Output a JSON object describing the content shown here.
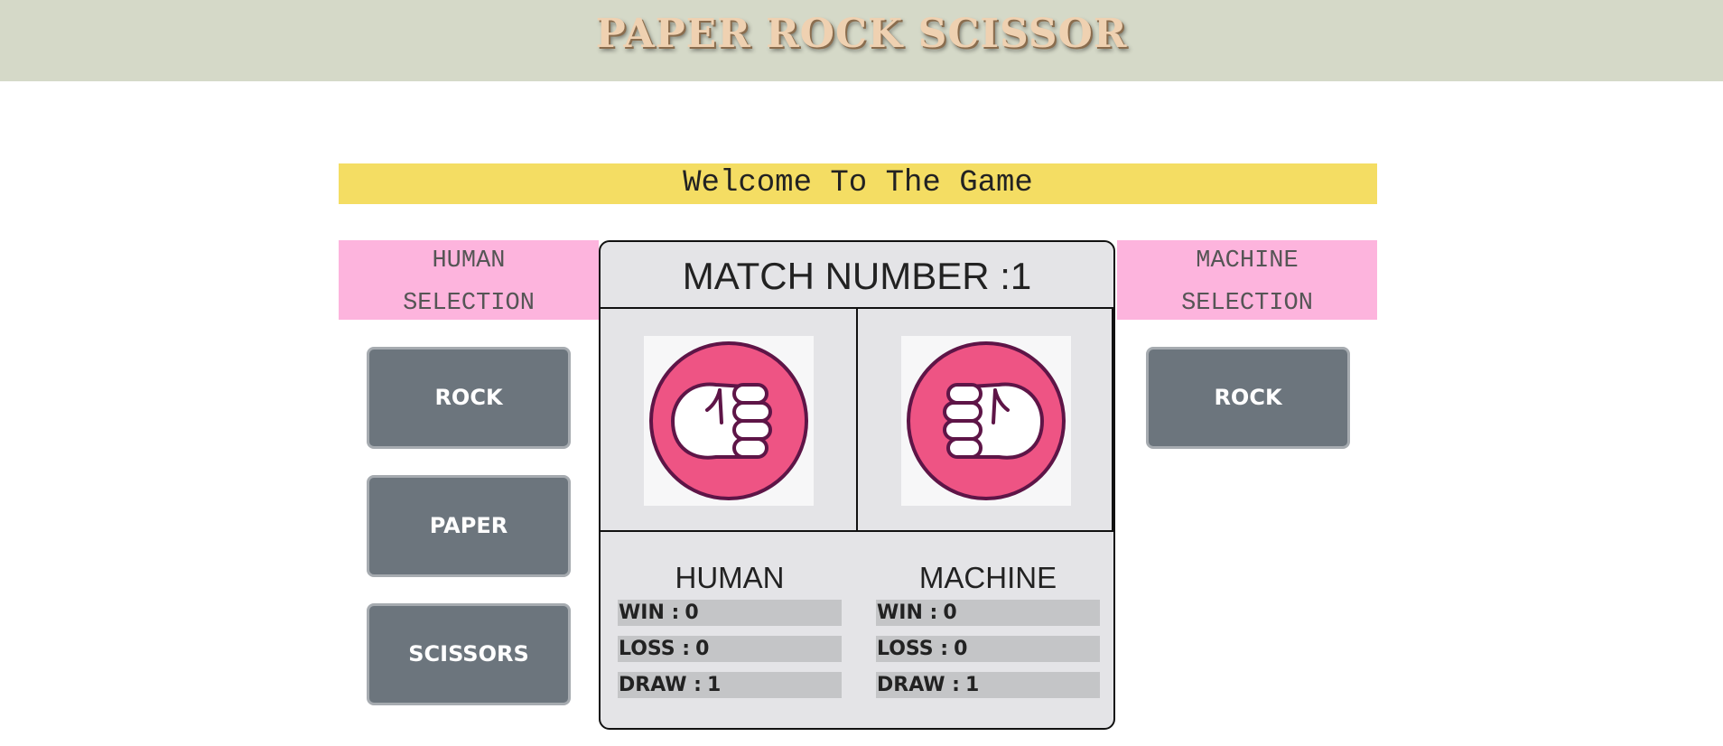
{
  "header": {
    "title": "PAPER ROCK SCISSOR"
  },
  "welcome": "Welcome To The Game",
  "human_panel": {
    "title_line1": "HUMAN",
    "title_line2": "SELECTION",
    "buttons": [
      "ROCK",
      "PAPER",
      "SCISSORS"
    ]
  },
  "machine_panel": {
    "title_line1": "MACHINE",
    "title_line2": "SELECTION",
    "selection": "ROCK"
  },
  "board": {
    "match_label": "MATCH NUMBER :",
    "match_number": "1",
    "human_pick_icon": "fist-right-icon",
    "machine_pick_icon": "fist-left-icon",
    "human": {
      "name": "HUMAN",
      "win_label": "WIN :",
      "win": "0",
      "loss_label": "LOSS :",
      "loss": "0",
      "draw_label": "DRAW :",
      "draw": "1"
    },
    "machine": {
      "name": "MACHINE",
      "win_label": "WIN :",
      "win": "0",
      "loss_label": "LOSS :",
      "loss": "0",
      "draw_label": "DRAW :",
      "draw": "1"
    }
  },
  "colors": {
    "header_bg": "#d5d9c8",
    "welcome_bg": "#f4dd63",
    "selection_header_bg": "#fdb4dd",
    "button_bg": "#6c757d",
    "board_bg": "#e4e4e7",
    "stat_bg": "#c4c5c7",
    "icon_fill": "#ee5484",
    "icon_stroke": "#5e1547"
  }
}
